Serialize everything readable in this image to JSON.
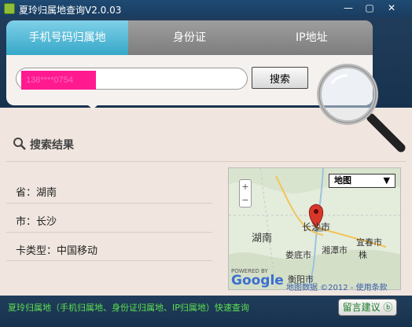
{
  "window": {
    "title": "夏玲归属地查询V2.0.03",
    "minimize": "—",
    "maximize": "▢",
    "close": "✕"
  },
  "tabs": [
    {
      "label": "手机号码归属地",
      "active": true
    },
    {
      "label": "身份证",
      "active": false
    },
    {
      "label": "IP地址",
      "active": false
    }
  ],
  "search": {
    "value": "138****0754",
    "button_label": "搜索"
  },
  "results": {
    "title": "搜索结果",
    "province": "省：湖南",
    "city": "市：长沙",
    "card_type": "卡类型：中国移动"
  },
  "map": {
    "type_select": "地图",
    "labels": {
      "hunan": "湖南",
      "changsha": "长沙市",
      "xiangtan": "湘潭市",
      "loudi": "娄底市",
      "hengyang": "衡阳市",
      "yichun": "宜春市",
      "zhuzhou": "株"
    },
    "powered_by": "POWERED BY",
    "google": "Google",
    "attribution": "地图数据 ©2012 - 使用条款"
  },
  "footer": {
    "text": "夏玲归属地（手机归属地、身份证归属地、IP归属地）快速查询",
    "feedback_label": "留言建议 ⓑ"
  },
  "colors": {
    "accent_tab": "#35a8c8",
    "footer_text": "#5ee04e",
    "marker": "#d9362b"
  }
}
